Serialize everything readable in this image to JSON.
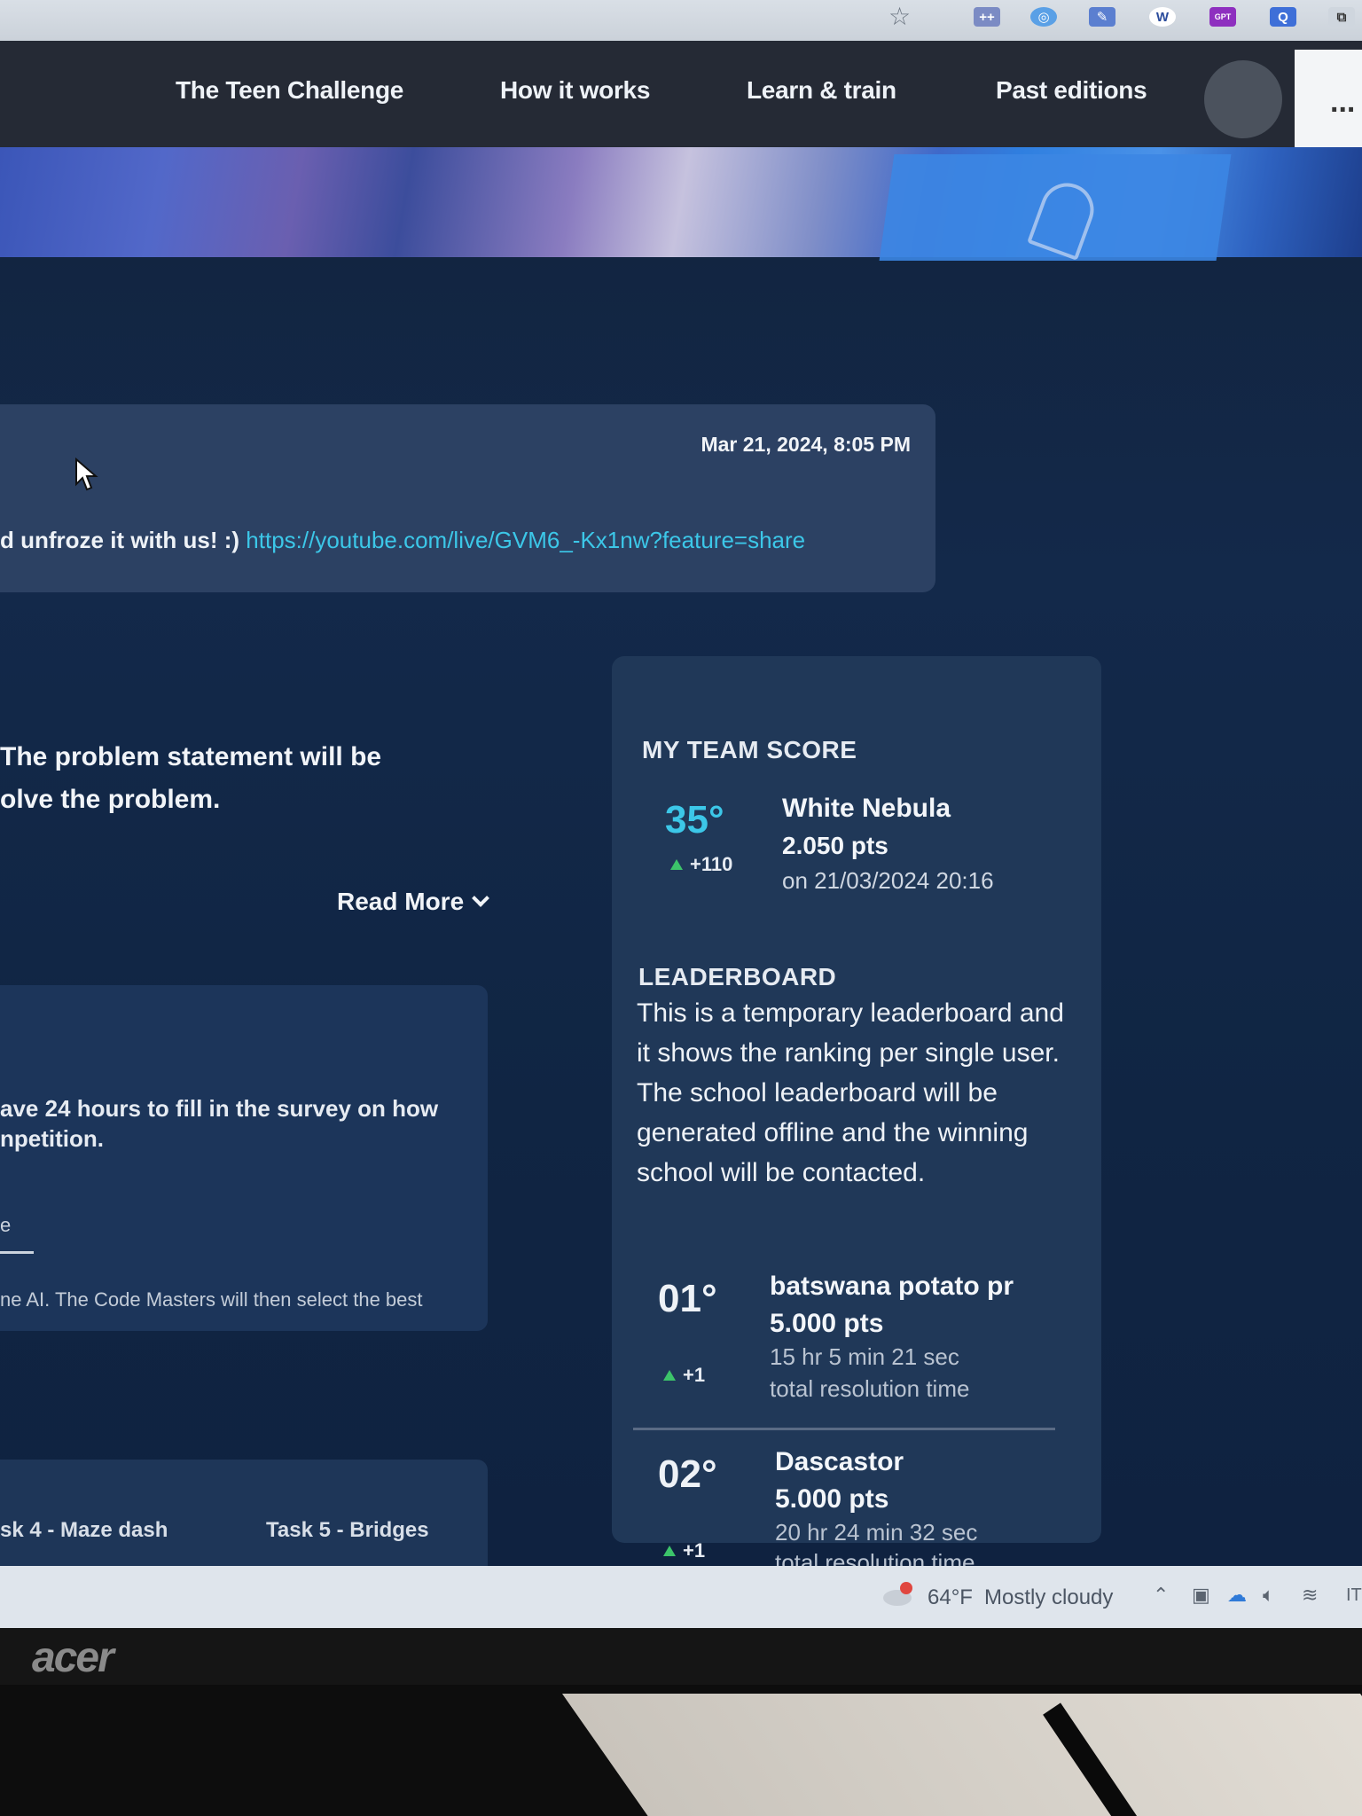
{
  "nav": {
    "items": [
      "The Teen Challenge",
      "How it works",
      "Learn & train",
      "Past editions"
    ],
    "more": "..."
  },
  "message": {
    "date": "Mar 21, 2024, 8:05 PM",
    "text": "d unfroze it with us! :) ",
    "link": "https://youtube.com/live/GVM6_-Kx1nw?feature=share"
  },
  "problem": {
    "line1": "The problem statement will be",
    "line2": "olve the problem.",
    "read_more": "Read More"
  },
  "survey": {
    "line1": "ave 24 hours to fill in the survey on how",
    "line2": "npetition.",
    "dot": "e",
    "footer": "ne AI. The Code Masters will then select the best"
  },
  "tasks": [
    "sk 4 - Maze dash",
    "Task 5 - Bridges"
  ],
  "my_team": {
    "heading": "MY TEAM SCORE",
    "rank": "35°",
    "delta": "+110",
    "name": "White Nebula",
    "points": "2.050 pts",
    "date": "on 21/03/2024 20:16"
  },
  "leaderboard": {
    "heading": "LEADERBOARD",
    "description": "This is a temporary leaderboard and it shows the ranking per single user. The school leaderboard will be generated offline and the winning school will be contacted.",
    "entries": [
      {
        "rank": "01°",
        "delta": "+1",
        "name": "batswana potato pr",
        "points": "5.000 pts",
        "time": "15 hr 5 min 21 sec",
        "time_label": "total resolution time"
      },
      {
        "rank": "02°",
        "delta": "+1",
        "name": "Dascastor",
        "points": "5.000 pts",
        "time": "20 hr 24 min 32 sec",
        "time_label": "total resolution time"
      }
    ]
  },
  "taskbar": {
    "temperature": "64°F",
    "weather": "Mostly cloudy",
    "language": "IT"
  },
  "bezel": {
    "brand": "acer"
  },
  "colors": {
    "accent_cyan": "#3cc7e8",
    "up_green": "#3cc46a",
    "panel": "#203858"
  }
}
